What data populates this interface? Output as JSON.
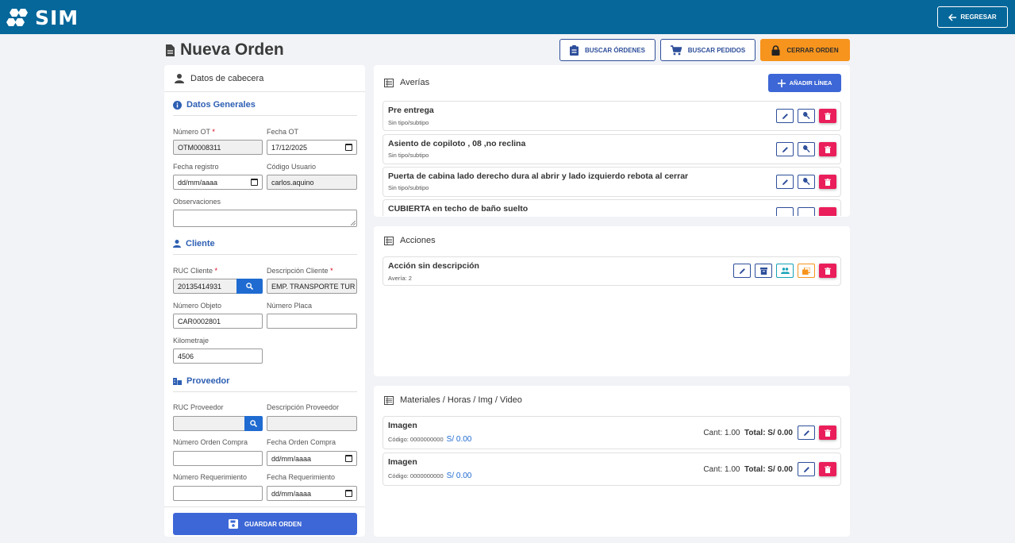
{
  "header": {
    "logo_text": "SIM",
    "back_label": "REGRESAR"
  },
  "page": {
    "title": "Nueva Orden"
  },
  "top_actions": {
    "buscar_ordenes": "BUSCAR ÓRDENES",
    "buscar_pedidos": "BUSCAR PEDIDOS",
    "cerrar_orden": "CERRAR ORDEN"
  },
  "left": {
    "header": "Datos de cabecera",
    "datos_generales": {
      "title": "Datos Generales",
      "numero_ot_label": "Número OT",
      "numero_ot_value": "OTM0008311",
      "fecha_ot_label": "Fecha OT",
      "fecha_ot_value": "17/12/2025",
      "fecha_registro_label": "Fecha registro",
      "fecha_registro_value": "dd/mm/aaaa",
      "codigo_usuario_label": "Código Usuario",
      "codigo_usuario_value": "carlos.aquino",
      "observaciones_label": "Observaciones",
      "observaciones_value": ""
    },
    "cliente": {
      "title": "Cliente",
      "ruc_label": "RUC Cliente",
      "ruc_value": "20135414931",
      "descripcion_label": "Descripción Cliente",
      "descripcion_value": "EMP. TRANSPORTE TUR",
      "numero_objeto_label": "Número Objeto",
      "numero_objeto_value": "CAR0002801",
      "numero_placa_label": "Número Placa",
      "numero_placa_value": "",
      "kilometraje_label": "Kilometraje",
      "kilometraje_value": "4506"
    },
    "proveedor": {
      "title": "Proveedor",
      "ruc_label": "RUC Proveedor",
      "ruc_value": "",
      "descripcion_label": "Descripción Proveedor",
      "descripcion_value": "",
      "orden_compra_label": "Número Orden Compra",
      "orden_compra_value": "",
      "fecha_orden_compra_label": "Fecha Orden Compra",
      "fecha_orden_compra_value": "dd/mm/aaaa",
      "requerimiento_label": "Número Requerimiento",
      "requerimiento_value": "",
      "fecha_requerimiento_label": "Fecha Requerimiento",
      "fecha_requerimiento_value": "dd/mm/aaaa"
    },
    "required_mark": "*",
    "save_label": "GUARDAR ORDEN"
  },
  "averias": {
    "title": "Averías",
    "add_label": "AÑADIR LÍNEA",
    "items": [
      {
        "title": "Pre entrega",
        "sub": "Sin tipo/subtipo"
      },
      {
        "title": "Asiento de copiloto , 08 ,no reclina",
        "sub": "Sin tipo/subtipo"
      },
      {
        "title": "Puerta de cabina lado derecho dura al abrir y lado izquierdo rebota al cerrar",
        "sub": "Sin tipo/subtipo"
      },
      {
        "title": "CUBIERTA en techo de baño suelto",
        "sub": ""
      }
    ]
  },
  "acciones": {
    "title": "Acciones",
    "items": [
      {
        "title": "Acción sin descripción",
        "sub": "Avería: 2"
      }
    ]
  },
  "materiales": {
    "title": "Materiales / Horas / Img / Video",
    "items": [
      {
        "title": "Imagen",
        "codigo": "Código: 0000000000",
        "price": "S/ 0.00",
        "cant": "Cant: 1.00",
        "total": "Total: S/ 0.00"
      },
      {
        "title": "Imagen",
        "codigo": "Código: 0000000000",
        "price": "S/ 0.00",
        "cant": "Cant: 1.00",
        "total": "Total: S/ 0.00"
      }
    ]
  },
  "colors": {
    "topbar": "#05679a",
    "primary": "#3d67d6",
    "danger": "#ea1e5a",
    "warning": "#f7941d"
  }
}
